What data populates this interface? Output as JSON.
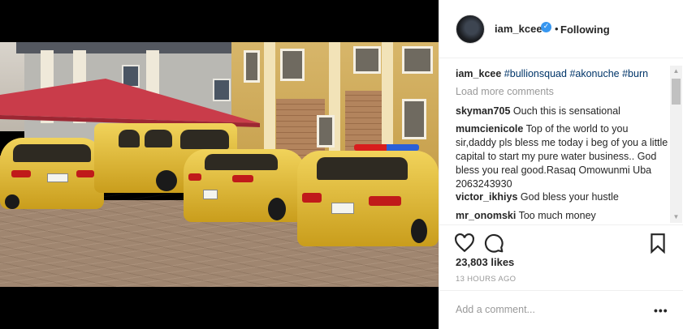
{
  "post": {
    "username": "iam_kcee",
    "verified_symbol": "✓",
    "separator": "•",
    "follow_status": "Following"
  },
  "caption": {
    "username": "iam_kcee",
    "tags": [
      "#bullionsquad",
      "#akonuche",
      "#burn"
    ]
  },
  "load_more": "Load more comments",
  "comments": [
    {
      "username": "skyman705",
      "text": "Ouch this is sensational"
    },
    {
      "username": "mumcienicole",
      "text": "Top of the world to you sir,daddy pls bless me today i beg of you a little capital to start my pure water business.. God bless you real good.Rasaq Omowunmi Uba 2063243930"
    },
    {
      "username": "victor_ikhiys",
      "text": "God bless your hustle"
    },
    {
      "username": "mr_onomski",
      "text": "Too much money"
    }
  ],
  "actions": {
    "like_icon": "heart-icon",
    "comment_icon": "comment-icon",
    "save_icon": "bookmark-icon"
  },
  "likes": "23,803 likes",
  "timestamp": "13 HOURS AGO",
  "add_comment_placeholder": "Add a comment...",
  "more_options": "•••",
  "colors": {
    "verified": "#3897f0",
    "hashtag": "#003569",
    "muted": "#999999",
    "text": "#262626",
    "car_gold": "#d9b232"
  }
}
